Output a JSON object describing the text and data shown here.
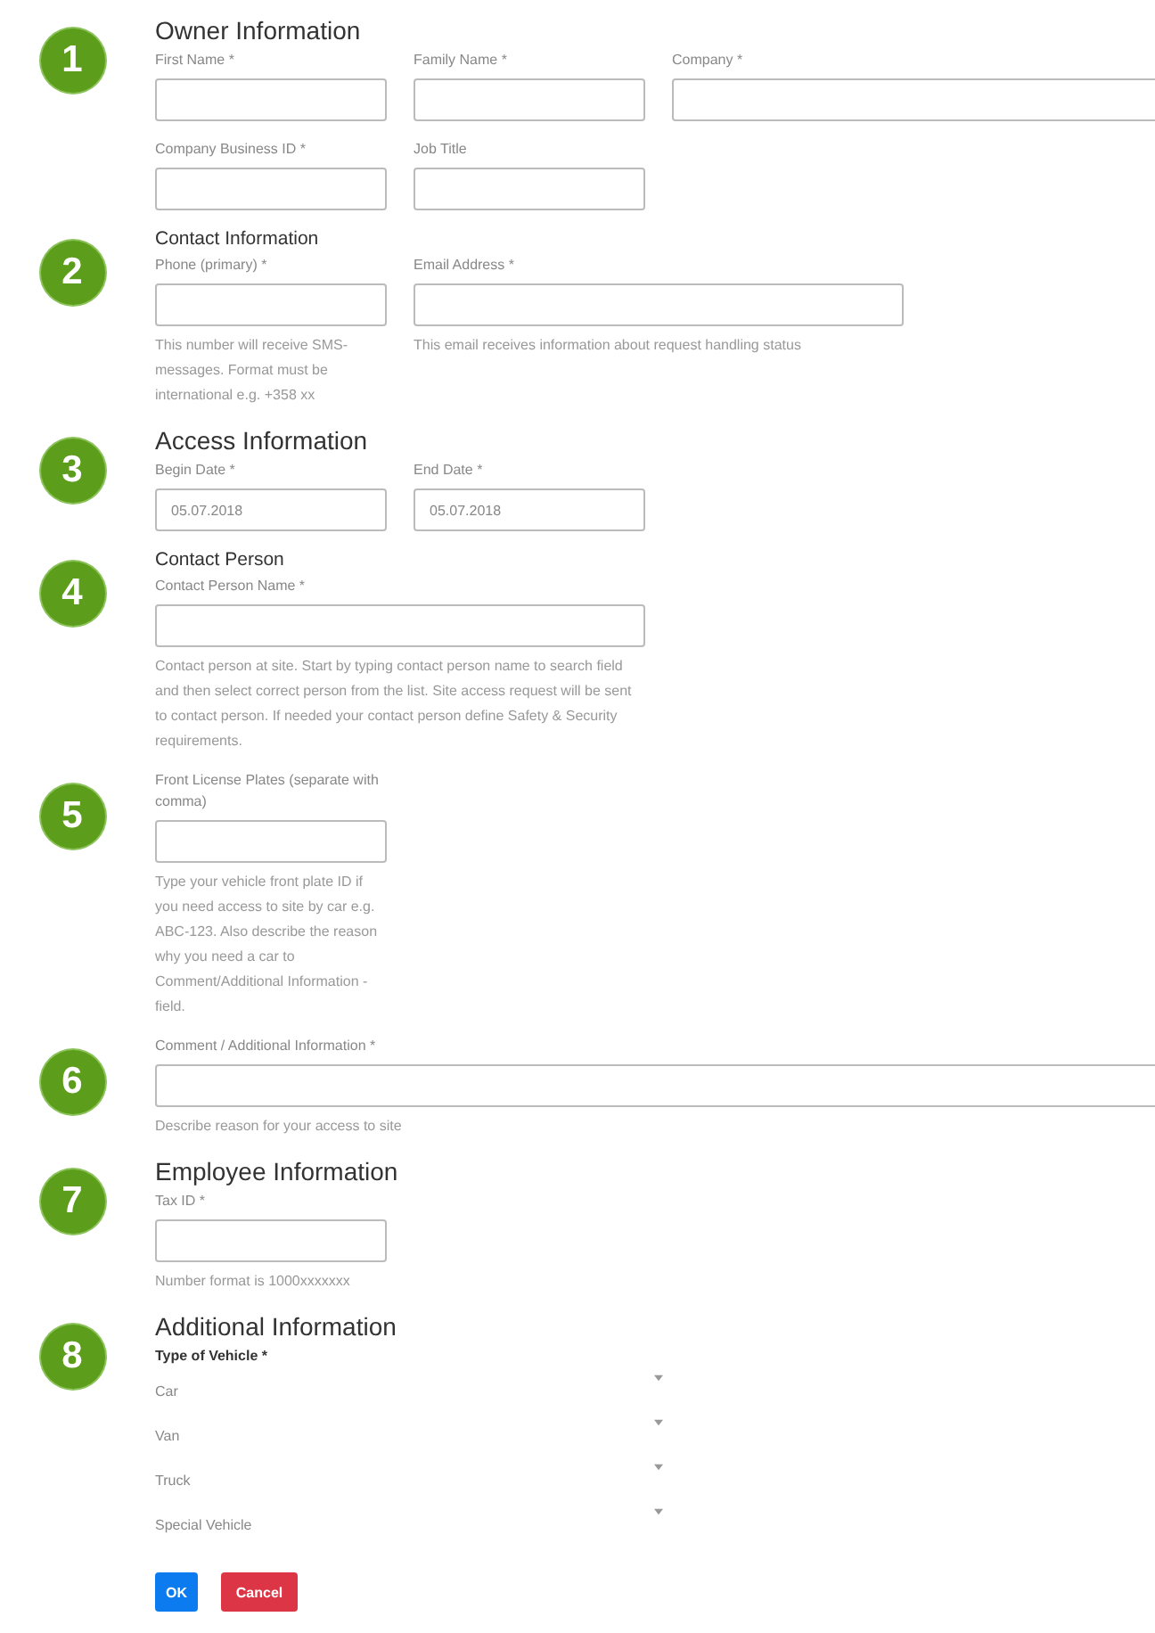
{
  "sections": [
    {
      "badge": "1",
      "title": "Owner Information",
      "kind": "major",
      "rows": [
        [
          {
            "label": "First Name *",
            "kind": "narrow"
          },
          {
            "label": "Family Name *",
            "kind": "narrow"
          },
          {
            "label": "Company *",
            "kind": "fill"
          }
        ],
        [
          {
            "label": "Company Business ID *",
            "kind": "narrow"
          },
          {
            "label": "Job Title",
            "kind": "narrow"
          }
        ]
      ]
    },
    {
      "badge": "2",
      "title": "Contact Information",
      "kind": "minor",
      "rows": [
        [
          {
            "label": "Phone (primary) *",
            "kind": "narrow",
            "help": "This number will receive SMS-messages. Format must be international e.g. +358 xx"
          },
          {
            "label": "Email Address *",
            "kind": "wide",
            "help": "This email receives information about request handling status"
          }
        ]
      ]
    },
    {
      "badge": "3",
      "title": "Access Information",
      "kind": "major",
      "rows": [
        [
          {
            "label": "Begin Date *",
            "kind": "narrow",
            "value": "05.07.2018"
          },
          {
            "label": "End Date *",
            "kind": "narrow",
            "value": "05.07.2018"
          }
        ]
      ]
    },
    {
      "badge": "4",
      "title": "Contact Person",
      "kind": "minor",
      "rows": [
        [
          {
            "label": "Contact Person Name *",
            "kind": "wide",
            "help": "Contact person at site. Start by typing contact person name to search field and then select correct person from the list. Site access request will be sent to contact person. If needed your contact person define Safety & Security requirements."
          }
        ]
      ]
    },
    {
      "badge": "5",
      "rows": [
        [
          {
            "label": "Front License Plates (separate with comma)",
            "kind": "narrow",
            "help": "Type your vehicle front plate ID if you need access to site by car e.g. ABC-123. Also describe the reason why you need a car to Comment/Additional Information -field."
          }
        ]
      ]
    },
    {
      "badge": "6",
      "rows": [
        [
          {
            "label": "Comment / Additional Information *",
            "kind": "fill",
            "help": "Describe reason for your access to site"
          }
        ]
      ]
    },
    {
      "badge": "7",
      "title": "Employee Information",
      "kind": "major",
      "rows": [
        [
          {
            "label": "Tax ID *",
            "kind": "narrow",
            "help": "Number format is 1000xxxxxxx"
          }
        ]
      ]
    },
    {
      "badge": "8",
      "title": "Additional Information",
      "kind": "major",
      "group": {
        "label": "Type of Vehicle *",
        "options": [
          "Car",
          "Van",
          "Truck",
          "Special Vehicle"
        ]
      }
    }
  ],
  "buttons": [
    {
      "label": "OK",
      "kind": "primary"
    },
    {
      "label": "Cancel",
      "kind": "danger"
    }
  ]
}
